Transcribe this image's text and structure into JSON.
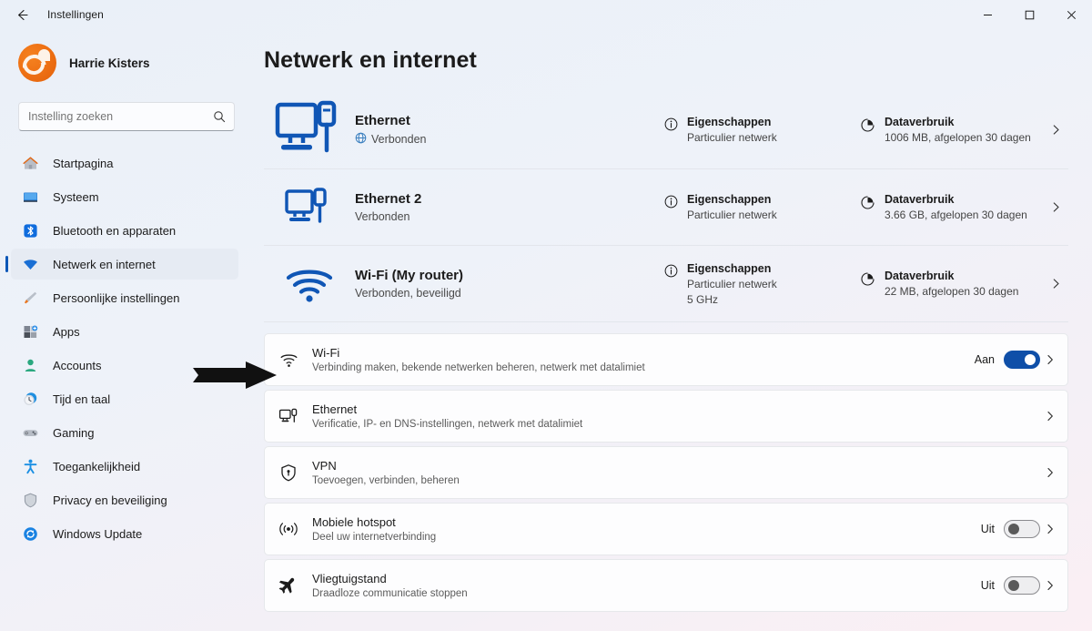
{
  "window": {
    "title": "Instellingen",
    "back_icon": "back-arrow-icon",
    "minimize": "—",
    "maximize": "□",
    "close": "✕"
  },
  "sidebar": {
    "profile": {
      "name": "Harrie Kisters",
      "avatar": "user-avatar"
    },
    "search": {
      "placeholder": "Instelling zoeken",
      "value": "",
      "icon": "search-icon"
    },
    "items": [
      {
        "label": "Startpagina",
        "icon": "home-icon",
        "selected": false
      },
      {
        "label": "Systeem",
        "icon": "system-monitor-icon",
        "selected": false
      },
      {
        "label": "Bluetooth en apparaten",
        "icon": "bluetooth-icon",
        "selected": false
      },
      {
        "label": "Netwerk en internet",
        "icon": "wifi-icon",
        "selected": true
      },
      {
        "label": "Persoonlijke instellingen",
        "icon": "paintbrush-icon",
        "selected": false
      },
      {
        "label": "Apps",
        "icon": "apps-icon",
        "selected": false
      },
      {
        "label": "Accounts",
        "icon": "account-person-icon",
        "selected": false
      },
      {
        "label": "Tijd en taal",
        "icon": "clock-icon",
        "selected": false
      },
      {
        "label": "Gaming",
        "icon": "gamepad-icon",
        "selected": false
      },
      {
        "label": "Toegankelijkheid",
        "icon": "accessibility-icon",
        "selected": false
      },
      {
        "label": "Privacy en beveiliging",
        "icon": "shield-icon",
        "selected": false
      },
      {
        "label": "Windows Update",
        "icon": "update-refresh-icon",
        "selected": false
      }
    ]
  },
  "main": {
    "page_title": "Netwerk en internet",
    "status_rows": [
      {
        "icon": "ethernet-monitor-large-icon",
        "name": "Ethernet",
        "state": "Verbonden",
        "state_icon": "globe-icon",
        "state2": "",
        "properties_title": "Eigenschappen",
        "properties_sub": "Particulier netwerk",
        "properties_sub2": "",
        "data_title": "Dataverbruik",
        "data_sub": "1006 MB, afgelopen 30 dagen"
      },
      {
        "icon": "ethernet-monitor-icon",
        "name": "Ethernet 2",
        "state": "Verbonden",
        "state_icon": "",
        "state2": "",
        "properties_title": "Eigenschappen",
        "properties_sub": "Particulier netwerk",
        "properties_sub2": "",
        "data_title": "Dataverbruik",
        "data_sub": "3.66 GB, afgelopen 30 dagen"
      },
      {
        "icon": "wifi-signal-icon",
        "name": "Wi-Fi (My router)",
        "state": "Verbonden, beveiligd",
        "state_icon": "",
        "state2": "",
        "properties_title": "Eigenschappen",
        "properties_sub": "Particulier netwerk",
        "properties_sub2": "5 GHz",
        "data_title": "Dataverbruik",
        "data_sub": "22 MB, afgelopen 30 dagen"
      }
    ],
    "cards": [
      {
        "icon": "wifi-small-icon",
        "title": "Wi-Fi",
        "sub": "Verbinding maken, bekende netwerken beheren, netwerk met datalimiet",
        "toggle_label": "Aan",
        "toggle_state": "on",
        "has_toggle": true
      },
      {
        "icon": "ethernet-card-icon",
        "title": "Ethernet",
        "sub": "Verificatie, IP- en DNS-instellingen, netwerk met datalimiet",
        "toggle_label": "",
        "toggle_state": "",
        "has_toggle": false
      },
      {
        "icon": "vpn-shield-icon",
        "title": "VPN",
        "sub": "Toevoegen, verbinden, beheren",
        "toggle_label": "",
        "toggle_state": "",
        "has_toggle": false
      },
      {
        "icon": "hotspot-broadcast-icon",
        "title": "Mobiele hotspot",
        "sub": "Deel uw internetverbinding",
        "toggle_label": "Uit",
        "toggle_state": "off",
        "has_toggle": true
      },
      {
        "icon": "airplane-icon",
        "title": "Vliegtuigstand",
        "sub": "Draadloze communicatie stoppen",
        "toggle_label": "Uit",
        "toggle_state": "off",
        "has_toggle": true
      }
    ]
  },
  "annotation": {
    "arrow": "black-pointer-arrow"
  },
  "colors": {
    "accent": "#0f4fa8",
    "network_blue": "#1056b5",
    "selected_bg": "#e6ebf3",
    "card_bg": "#fdfdfe"
  }
}
